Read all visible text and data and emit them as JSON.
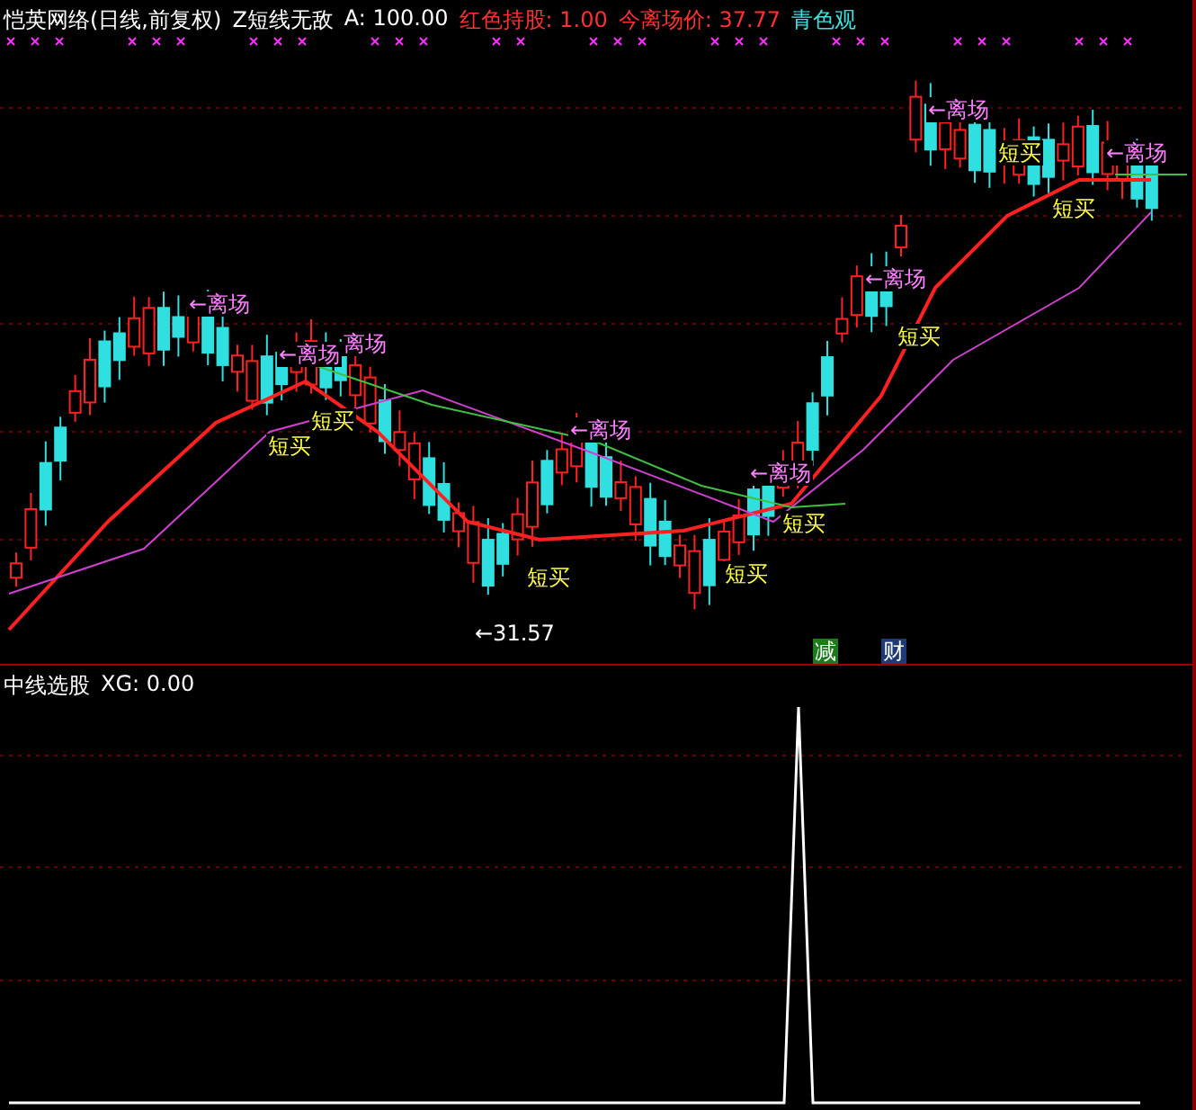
{
  "header": {
    "title": "恺英网络(日线,前复权)",
    "indicator": "Z短线无敌",
    "value_a": "A: 100.00",
    "hold": "红色持股: 1.00",
    "exit_price": "今离场价: 37.77",
    "cut_label": "青色观"
  },
  "main_chart": {
    "annotations": [
      {
        "kind": "exit",
        "text": "←离场"
      },
      {
        "kind": "exit",
        "text": "←离场"
      },
      {
        "kind": "exit",
        "text": "离场"
      },
      {
        "kind": "buy",
        "text": "短买"
      },
      {
        "kind": "buy",
        "text": "短买"
      },
      {
        "kind": "exit",
        "text": "←离场"
      },
      {
        "kind": "buy",
        "text": "短买"
      },
      {
        "kind": "low",
        "text": "←31.57"
      },
      {
        "kind": "exit",
        "text": "←离场"
      },
      {
        "kind": "buy",
        "text": "短买"
      },
      {
        "kind": "buy",
        "text": "短买"
      },
      {
        "kind": "exit",
        "text": "←离场"
      },
      {
        "kind": "buy",
        "text": "短买"
      },
      {
        "kind": "exit",
        "text": "←离场"
      },
      {
        "kind": "buy",
        "text": "短买"
      },
      {
        "kind": "buy",
        "text": "短买"
      },
      {
        "kind": "exit",
        "text": "←离场"
      }
    ],
    "tags": [
      {
        "text": "减",
        "color": "#1d7a1d"
      },
      {
        "text": "财",
        "color": "#203a78"
      }
    ]
  },
  "lower_panel": {
    "title": "中线选股",
    "xg": "XG: 0.00"
  }
}
